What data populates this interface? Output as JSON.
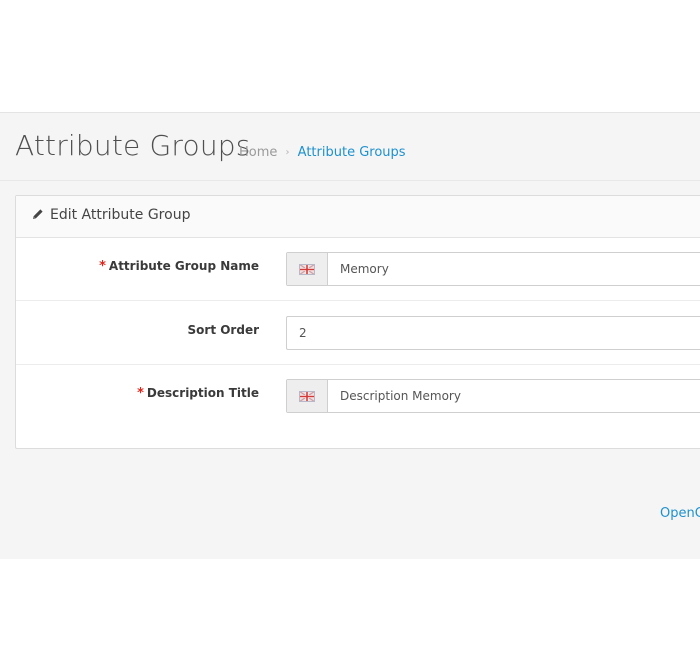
{
  "header": {
    "title": "Attribute Groups",
    "breadcrumb": {
      "home": "Home",
      "separator": "›",
      "current": "Attribute Groups"
    }
  },
  "panel": {
    "title": "Edit Attribute Group",
    "icon": "pencil-icon"
  },
  "form": {
    "name": {
      "label": "Attribute Group Name",
      "required": "*",
      "value": "Memory",
      "icon": "uk-flag-icon"
    },
    "sort_order": {
      "label": "Sort Order",
      "value": "2"
    },
    "description_title": {
      "label": "Description Title",
      "required": "*",
      "value": "Description Memory",
      "icon": "uk-flag-icon"
    }
  },
  "footer": {
    "link": "OpenC"
  },
  "colors": {
    "accent": "#1e91cf",
    "required": "#e3241b",
    "background": "#f5f5f5"
  }
}
